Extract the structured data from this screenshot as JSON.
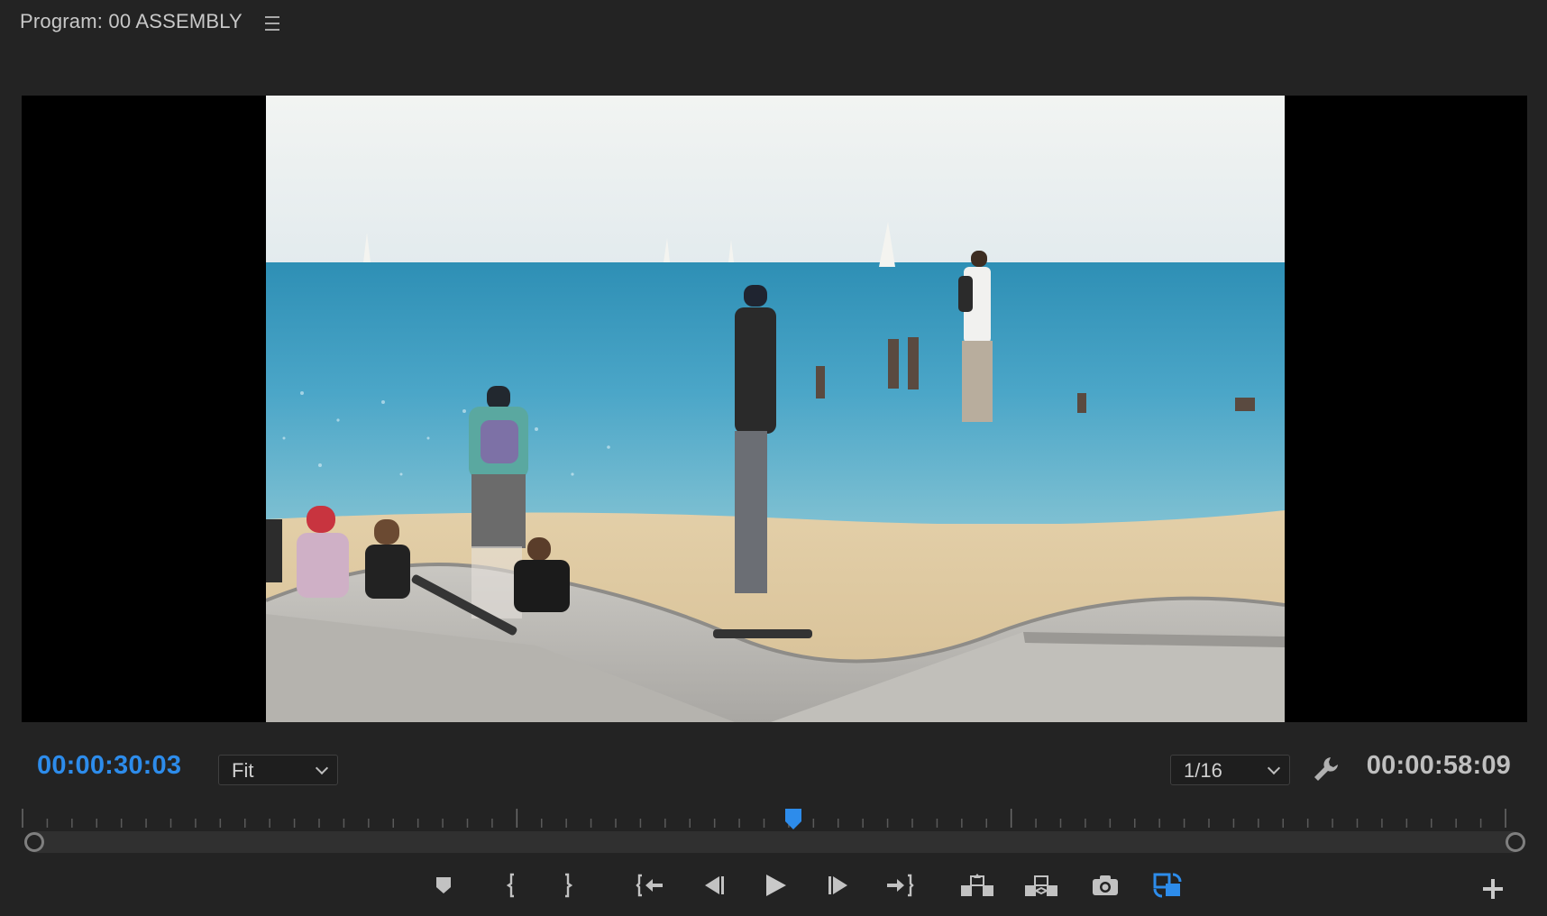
{
  "panel": {
    "title": "Program: 00 ASSEMBLY",
    "menu_icon": "hamburger-menu-icon"
  },
  "timecode": {
    "current": "00:00:30:03",
    "duration": "00:00:58:09"
  },
  "zoom": {
    "selected": "Fit"
  },
  "resolution": {
    "selected": "1/16"
  },
  "settings_icon": "wrench-icon",
  "playhead_position": 0.52,
  "colors": {
    "accent": "#2d8ceb",
    "background": "#232323",
    "monitor": "#000000"
  },
  "transport": [
    {
      "name": "add-marker-button",
      "icon": "marker-icon"
    },
    {
      "name": "mark-in-button",
      "icon": "mark-in-icon"
    },
    {
      "name": "mark-out-button",
      "icon": "mark-out-icon"
    },
    {
      "name": "go-to-in-button",
      "icon": "go-to-in-icon"
    },
    {
      "name": "step-back-button",
      "icon": "step-back-icon"
    },
    {
      "name": "play-button",
      "icon": "play-icon"
    },
    {
      "name": "step-forward-button",
      "icon": "step-forward-icon"
    },
    {
      "name": "go-to-out-button",
      "icon": "go-to-out-icon"
    },
    {
      "name": "lift-button",
      "icon": "lift-icon"
    },
    {
      "name": "extract-button",
      "icon": "extract-icon"
    },
    {
      "name": "export-frame-button",
      "icon": "camera-icon"
    },
    {
      "name": "comparison-view-button",
      "icon": "compare-icon"
    },
    {
      "name": "button-editor-button",
      "icon": "plus-icon"
    }
  ]
}
